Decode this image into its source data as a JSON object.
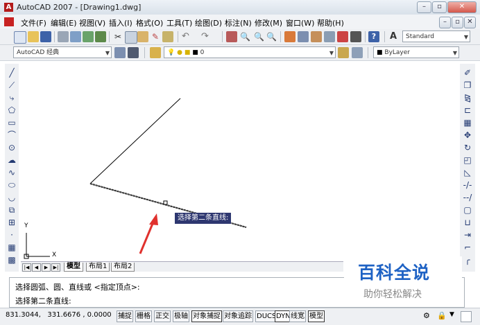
{
  "window": {
    "title": "AutoCAD 2007 - [Drawing1.dwg]"
  },
  "menu": [
    {
      "label": "文件(F)"
    },
    {
      "label": "编辑(E)"
    },
    {
      "label": "视图(V)"
    },
    {
      "label": "插入(I)"
    },
    {
      "label": "格式(O)"
    },
    {
      "label": "工具(T)"
    },
    {
      "label": "绘图(D)"
    },
    {
      "label": "标注(N)"
    },
    {
      "label": "修改(M)"
    },
    {
      "label": "窗口(W)"
    },
    {
      "label": "帮助(H)"
    }
  ],
  "toolbar": {
    "text_style": "Standard",
    "workspace": "AutoCAD 经典",
    "layer": "0",
    "color": "ByLayer"
  },
  "tooltip": {
    "prompt": "选择第二条直线:"
  },
  "ucs": {
    "x_label": "X",
    "y_label": "Y"
  },
  "tabs": [
    {
      "label": "模型"
    },
    {
      "label": "布局1"
    },
    {
      "label": "布局2"
    }
  ],
  "command": {
    "line1": "选择圆弧、圆、直线或 <指定顶点>:",
    "line2": "选择第二条直线:"
  },
  "status": {
    "coords": "831.3044,   331.6676 , 0.0000",
    "buttons": [
      {
        "label": "捕捉",
        "on": false
      },
      {
        "label": "栅格",
        "on": false
      },
      {
        "label": "正交",
        "on": false
      },
      {
        "label": "极轴",
        "on": false
      },
      {
        "label": "对象捕捉",
        "on": true
      },
      {
        "label": "对象追踪",
        "on": false
      },
      {
        "label": "DUCS",
        "on": false
      },
      {
        "label": "DYN",
        "on": true
      },
      {
        "label": "线宽",
        "on": false
      },
      {
        "label": "模型",
        "on": true
      }
    ]
  },
  "watermark": {
    "title": "百科全说",
    "subtitle": "助你轻松解决"
  },
  "colors": {
    "accent_red": "#e0312d",
    "tooltip_bg": "#2e3770",
    "watermark_blue": "#1e62c4"
  }
}
